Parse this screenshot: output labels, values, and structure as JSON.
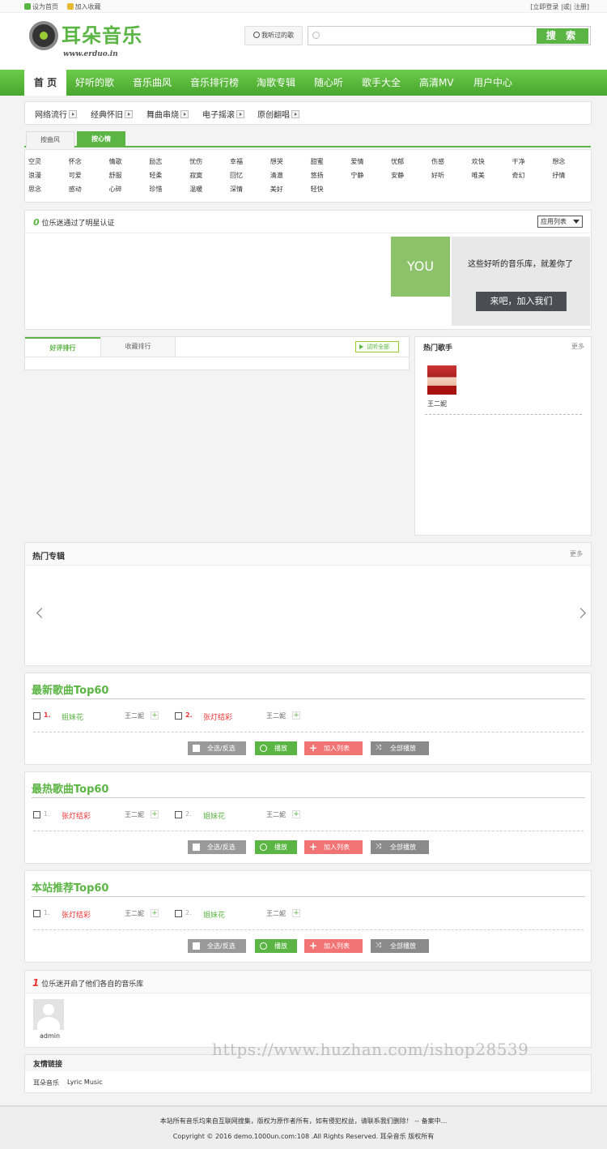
{
  "topbar": {
    "set_home": "设为首页",
    "add_fav": "加入收藏",
    "login": "立即登录",
    "sep": "|或|",
    "register": "注册"
  },
  "logo": {
    "name": "耳朵音乐",
    "url": "www.erduo.in"
  },
  "header": {
    "history": "我听过的歌",
    "search_placeholder": "",
    "search_button": "搜 索"
  },
  "nav": [
    "首 页",
    "好听的歌",
    "音乐曲风",
    "音乐排行榜",
    "淘歌专辑",
    "随心听",
    "歌手大全",
    "高清MV",
    "用户中心"
  ],
  "genres": [
    "网络流行",
    "经典怀旧",
    "舞曲串烧",
    "电子摇滚",
    "原创翻唱"
  ],
  "mood_tabs": {
    "off": "按曲风",
    "on": "按心情"
  },
  "moods": [
    "空灵",
    "怀念",
    "情歌",
    "励志",
    "忧伤",
    "幸福",
    "想哭",
    "甜蜜",
    "爱情",
    "忧郁",
    "伤感",
    "欢快",
    "干净",
    "想念",
    "浪漫",
    "可爱",
    "舒服",
    "轻柔",
    "寂寞",
    "回忆",
    "清澈",
    "悠扬",
    "宁静",
    "安静",
    "好听",
    "唯美",
    "奇幻",
    "抒情",
    "思念",
    "感动",
    "心碎",
    "珍惜",
    "温暖",
    "深情",
    "美好",
    "轻快"
  ],
  "star": {
    "count": "0",
    "text": "位乐迷通过了明星认证",
    "select": "应用列表",
    "you": "YOU",
    "slogan": "这些好听的音乐库，就差你了",
    "join": "来吧，加入我们"
  },
  "rank": {
    "tab_on": "好评排行",
    "tab_off": "收藏排行",
    "play_all": "试听全部"
  },
  "hot_singer": {
    "title": "热门歌手",
    "more": "更多",
    "name": "王二妮"
  },
  "hot_album": {
    "title": "热门专辑",
    "more": "更多"
  },
  "actions": {
    "select": "全选/反选",
    "play": "播放",
    "add": "加入列表",
    "all": "全部播放"
  },
  "lists": [
    {
      "title": "最新歌曲Top60",
      "songs": [
        {
          "no": "1.",
          "title": "姐妹花",
          "artist": "王二妮"
        },
        {
          "no": "2.",
          "title": "张灯结彩",
          "artist": "王二妮"
        }
      ]
    },
    {
      "title": "最热歌曲Top60",
      "songs": [
        {
          "no": "1.",
          "title": "张灯结彩",
          "artist": "王二妮"
        },
        {
          "no": "2.",
          "title": "姐妹花",
          "artist": "王二妮"
        }
      ]
    },
    {
      "title": "本站推荐Top60",
      "songs": [
        {
          "no": "1.",
          "title": "张灯结彩",
          "artist": "王二妮"
        },
        {
          "no": "2.",
          "title": "姐妹花",
          "artist": "王二妮"
        }
      ]
    }
  ],
  "fans": {
    "count": "1",
    "text": "位乐迷开启了他们各自的音乐库",
    "user": "admin"
  },
  "friends": {
    "title": "友情链接",
    "links": [
      "耳朵音乐",
      "Lyric Music"
    ]
  },
  "footer": {
    "line1": "本站所有音乐均来自互联网搜集，版权为原作者所有，如有侵犯权益，请联系我们删除！ -- 备案中...",
    "line2": "Copyright © 2016 demo.1000un.com:108 .All Rights Reserved. 耳朵音乐 版权所有"
  },
  "watermark": "https://www.huzhan.com/ishop28539",
  "colors": {
    "brand": "#5bb544",
    "red": "#e33333"
  }
}
